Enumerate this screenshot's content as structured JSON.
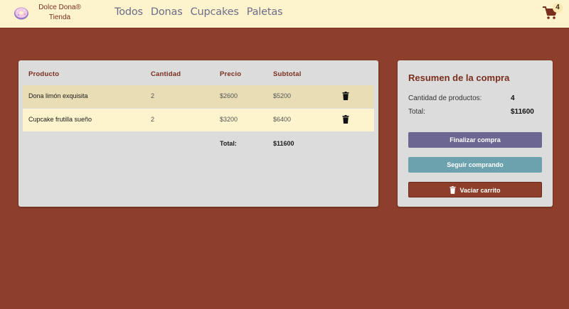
{
  "header": {
    "brand_line1": "Dolce Dona®",
    "brand_line2": "Tienda",
    "nav": [
      "Todos",
      "Donas",
      "Cupcakes",
      "Paletas"
    ],
    "cart_count": "4"
  },
  "table": {
    "headers": [
      "Producto",
      "Cantidad",
      "Precio",
      "Subtotal"
    ],
    "rows": [
      {
        "name": "Dona limón exquisita",
        "qty": "2",
        "price": "$2600",
        "subtotal": "$5200"
      },
      {
        "name": "Cupcake frutilla sueño",
        "qty": "2",
        "price": "$3200",
        "subtotal": "$6400"
      }
    ],
    "total_label": "Total:",
    "total_value": "$11600"
  },
  "summary": {
    "title": "Resumen de la compra",
    "qty_label": "Cantidad de productos:",
    "qty_value": "4",
    "total_label": "Total:",
    "total_value": "$11600",
    "btn_finalizar": "Finalizar compra",
    "btn_seguir": "Seguir comprando",
    "btn_vaciar": "Vaciar carrito"
  },
  "colors": {
    "background": "#8e3f2c",
    "header": "#fdf3cd",
    "accent": "#7a2e1e",
    "finalizar": "#6c6692",
    "seguir": "#6ba2ad"
  }
}
